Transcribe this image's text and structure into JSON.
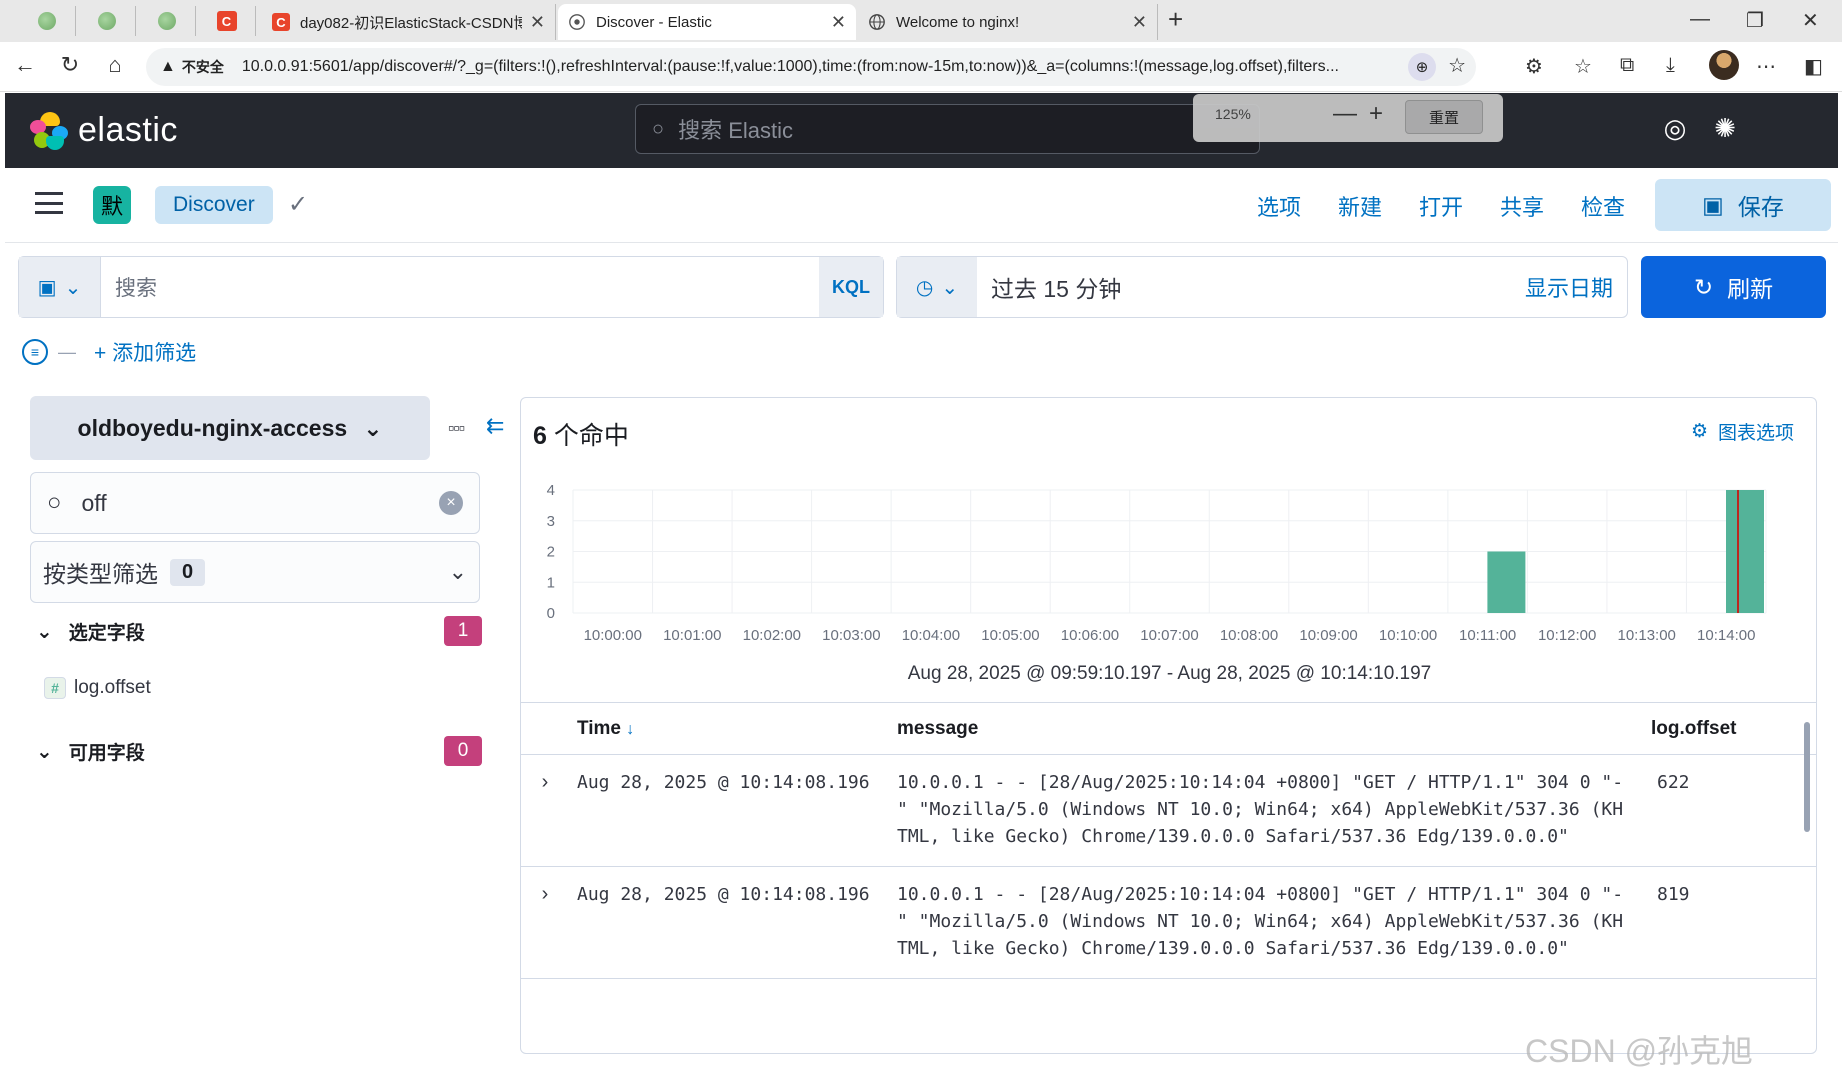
{
  "browser": {
    "tabs": [
      {
        "title": "day082-初识ElasticStack-CSDN博客",
        "icon": "csdn-icon",
        "active": false
      },
      {
        "title": "Discover - Elastic",
        "icon": "elastic-icon",
        "active": true
      },
      {
        "title": "Welcome to nginx!",
        "icon": "globe-icon",
        "active": false
      }
    ],
    "mini_tab_badge": "C",
    "csdn_badge": "C",
    "security_label": "不安全",
    "url": "10.0.0.91:5601/app/discover#/?_g=(filters:!(),refreshInterval:(pause:!f,value:1000),time:(from:now-15m,to:now))&_a=(columns:!(message,log.offset),filters...",
    "zoom_popup": {
      "percent": "125%",
      "reset_label": "重置"
    }
  },
  "kibana": {
    "logo_text": "elastic",
    "search_placeholder": "搜索 Elastic",
    "space_initial": "默",
    "breadcrumb": "Discover",
    "top_links": [
      "选项",
      "新建",
      "打开",
      "共享",
      "检查"
    ],
    "save_label": "保存",
    "query": {
      "placeholder": "搜索",
      "language": "KQL"
    },
    "date": {
      "range": "过去 15 分钟",
      "show_dates": "显示日期"
    },
    "refresh_label": "刷新",
    "add_filter": "+ 添加筛选"
  },
  "sidebar": {
    "index_pattern": "oldboyedu-nginx-access",
    "field_search_value": "off",
    "type_filter_label": "按类型筛选",
    "type_filter_count": "0",
    "selected_fields": {
      "label": "选定字段",
      "count": "1",
      "fields": [
        {
          "type": "#",
          "name": "log.offset"
        }
      ]
    },
    "available_fields": {
      "label": "可用字段",
      "count": "0"
    }
  },
  "main": {
    "hits_count": "6",
    "hits_label": "个命中",
    "chart_options": "图表选项",
    "time_range_label": "Aug 28, 2025 @ 09:59:10.197 - Aug 28, 2025 @ 10:14:10.197",
    "columns": [
      "Time",
      "message",
      "log.offset"
    ],
    "rows": [
      {
        "time": "Aug 28, 2025 @ 10:14:08.196",
        "message": "10.0.0.1 - - [28/Aug/2025:10:14:04 +0800] \"GET / HTTP/1.1\" 304 0 \"-\" \"Mozilla/5.0 (Windows NT 10.0; Win64; x64) AppleWebKit/537.36 (KHTML, like Gecko) Chrome/139.0.0.0 Safari/537.36 Edg/139.0.0.0\"",
        "offset": "622"
      },
      {
        "time": "Aug 28, 2025 @ 10:14:08.196",
        "message": "10.0.0.1 - - [28/Aug/2025:10:14:04 +0800] \"GET / HTTP/1.1\" 304 0 \"-\" \"Mozilla/5.0 (Windows NT 10.0; Win64; x64) AppleWebKit/537.36 (KHTML, like Gecko) Chrome/139.0.0.0 Safari/537.36 Edg/139.0.0.0\"",
        "offset": "819"
      }
    ]
  },
  "chart_data": {
    "type": "bar",
    "x": [
      "10:00:00",
      "10:01:00",
      "10:02:00",
      "10:03:00",
      "10:04:00",
      "10:05:00",
      "10:06:00",
      "10:07:00",
      "10:08:00",
      "10:09:00",
      "10:10:00",
      "10:11:00",
      "10:12:00",
      "10:13:00",
      "10:14:00"
    ],
    "bars": [
      {
        "time": "10:11:00",
        "value": 2
      },
      {
        "time": "10:14:00",
        "value": 4
      }
    ],
    "yticks": [
      0,
      1,
      2,
      3,
      4
    ],
    "ylim": [
      0,
      4
    ],
    "bar_color": "#54b399",
    "now_marker_color": "#bd271e"
  },
  "watermark": "CSDN @孙克旭",
  "colors": {
    "accent": "#0071c2",
    "primary_button": "#0b64dd",
    "header": "#25282f",
    "badge": "#c4407c"
  }
}
